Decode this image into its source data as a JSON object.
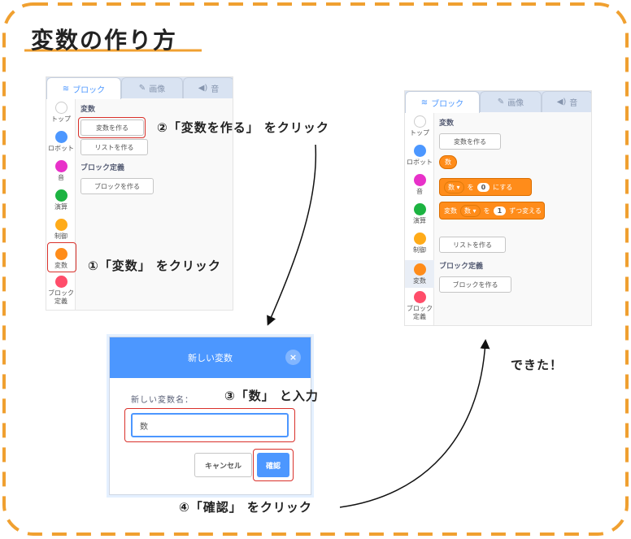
{
  "title": "変数の作り方",
  "colors": {
    "border": "#f0a030",
    "accent": "#4c97ff",
    "highlight": "#d9312b",
    "variables": "#ff8c1a"
  },
  "left_panel": {
    "tabs": [
      {
        "label": "ブロック",
        "icon": "code-blocks-icon"
      },
      {
        "label": "画像",
        "icon": "brush-icon"
      },
      {
        "label": "音",
        "icon": "speaker-icon"
      }
    ],
    "categories": [
      {
        "label": "トップ",
        "color": "#ffffff"
      },
      {
        "label": "ロボット",
        "color": "#4c97ff"
      },
      {
        "label": "音",
        "color": "#e831c9"
      },
      {
        "label": "演算",
        "color": "#1cb341"
      },
      {
        "label": "制御",
        "color": "#ffab19"
      },
      {
        "label": "変数",
        "color": "#ff8c1a"
      },
      {
        "label": "ブロック定義",
        "color": "#ff4d6a"
      }
    ],
    "section_variables": "変数",
    "make_variable": "変数を作る",
    "make_list": "リストを作る",
    "section_blocks": "ブロック定義",
    "make_block": "ブロックを作る"
  },
  "right_panel": {
    "tabs": [
      {
        "label": "ブロック",
        "icon": "code-blocks-icon"
      },
      {
        "label": "画像",
        "icon": "brush-icon"
      },
      {
        "label": "音",
        "icon": "speaker-icon"
      }
    ],
    "categories": [
      {
        "label": "トップ",
        "color": "#ffffff"
      },
      {
        "label": "ロボット",
        "color": "#4c97ff"
      },
      {
        "label": "音",
        "color": "#e831c9"
      },
      {
        "label": "演算",
        "color": "#1cb341"
      },
      {
        "label": "制御",
        "color": "#ffab19"
      },
      {
        "label": "変数",
        "color": "#ff8c1a"
      },
      {
        "label": "ブロック定義",
        "color": "#ff4d6a"
      }
    ],
    "section_variables": "変数",
    "make_variable": "変数を作る",
    "variable_reporter": "数",
    "set_block": {
      "dropdown": "数",
      "to": "を",
      "value": "0",
      "suffix": "にする"
    },
    "change_block": {
      "prefix": "変数",
      "dropdown": "数",
      "to": "を",
      "value": "1",
      "suffix": "ずつ変える"
    },
    "make_list": "リストを作る",
    "section_blocks": "ブロック定義",
    "make_block": "ブロックを作る"
  },
  "dialog": {
    "title": "新しい変数",
    "label": "新しい変数名：",
    "input_value": "数",
    "cancel": "キャンセル",
    "ok": "確認"
  },
  "steps": {
    "step1": "①「変数」 をクリック",
    "step2": "②「変数を作る」 をクリック",
    "step3": "③「数」 と入力",
    "step4": "④「確認」 をクリック",
    "done": "できた！"
  }
}
